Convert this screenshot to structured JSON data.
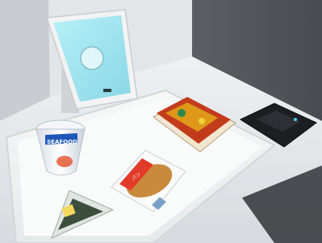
{
  "photo": {
    "product_labels": {
      "noodle_cup": "SEAFOOD",
      "pastry_pack": "パン"
    },
    "colors": {
      "wall": "#6b6d70",
      "counter": "#e9ecef",
      "tray": "#f4f6f6",
      "tablet_screen": "#9fe3ee",
      "card_reader": "#1c1e22",
      "noodle_accent": "#1f57b8",
      "yakisoba_sauce": "#c23c1b",
      "pastry_bun": "#c98a3d",
      "onigiri_band": "#3c4e3d"
    },
    "icons": [
      "tablet-kiosk",
      "card-reader",
      "instant-noodle-cup",
      "yakisoba-container",
      "onigiri",
      "packaged-bread"
    ]
  }
}
